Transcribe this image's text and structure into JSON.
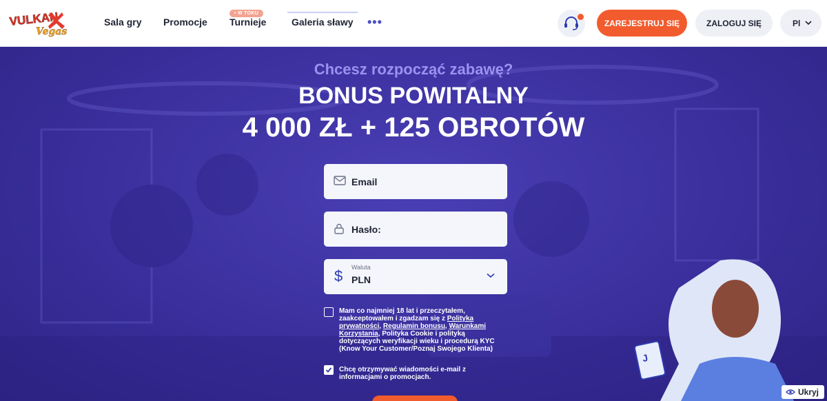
{
  "header": {
    "logo_text": "VULKAN Vegas",
    "nav": [
      {
        "label": "Sala gry"
      },
      {
        "label": "Promocje"
      },
      {
        "label": "Turnieje",
        "badge": "• W TOKU"
      },
      {
        "label": "Galeria sławy"
      }
    ],
    "more_label": "•••",
    "support_icon": "headset-icon",
    "register_label": "ZAREJESTRUJ SIĘ",
    "login_label": "ZALOGUJ SIĘ",
    "lang_label": "Pl"
  },
  "hero": {
    "subtitle": "Chcesz rozpocząć zabawę?",
    "title_line1": "BONUS POWITALNY",
    "title_line2": "4 000 ZŁ + 125 OBROTÓW"
  },
  "form": {
    "email_label": "Email",
    "password_label": "Hasło:",
    "currency_small_label": "Waluta",
    "currency_value": "PLN",
    "terms": {
      "part1": "Mam co najmniej 18 lat i przeczytałem, zaakceptowałem i zgadzam się z ",
      "link1": "Polityka prywatności",
      "sep1": ", ",
      "link2": "Regulamin bonusu",
      "sep2": ", ",
      "link3": "Warunkami Korzystania",
      "part2": ", Polityka Cookie i polityką dotyczących weryfikacji wieku i procedurą KYC (Know Your Customer/Poznaj Swojego Klienta)",
      "checked": false
    },
    "promo": {
      "text": "Chcę otrzymywać wiadomości e-mail z informacjami o promocjach.",
      "checked": true
    }
  },
  "hide_label": "Ukryj",
  "colors": {
    "accent": "#f25b2d",
    "hero_bg": "#3b2f9a",
    "subtitle": "#9b92f0"
  }
}
